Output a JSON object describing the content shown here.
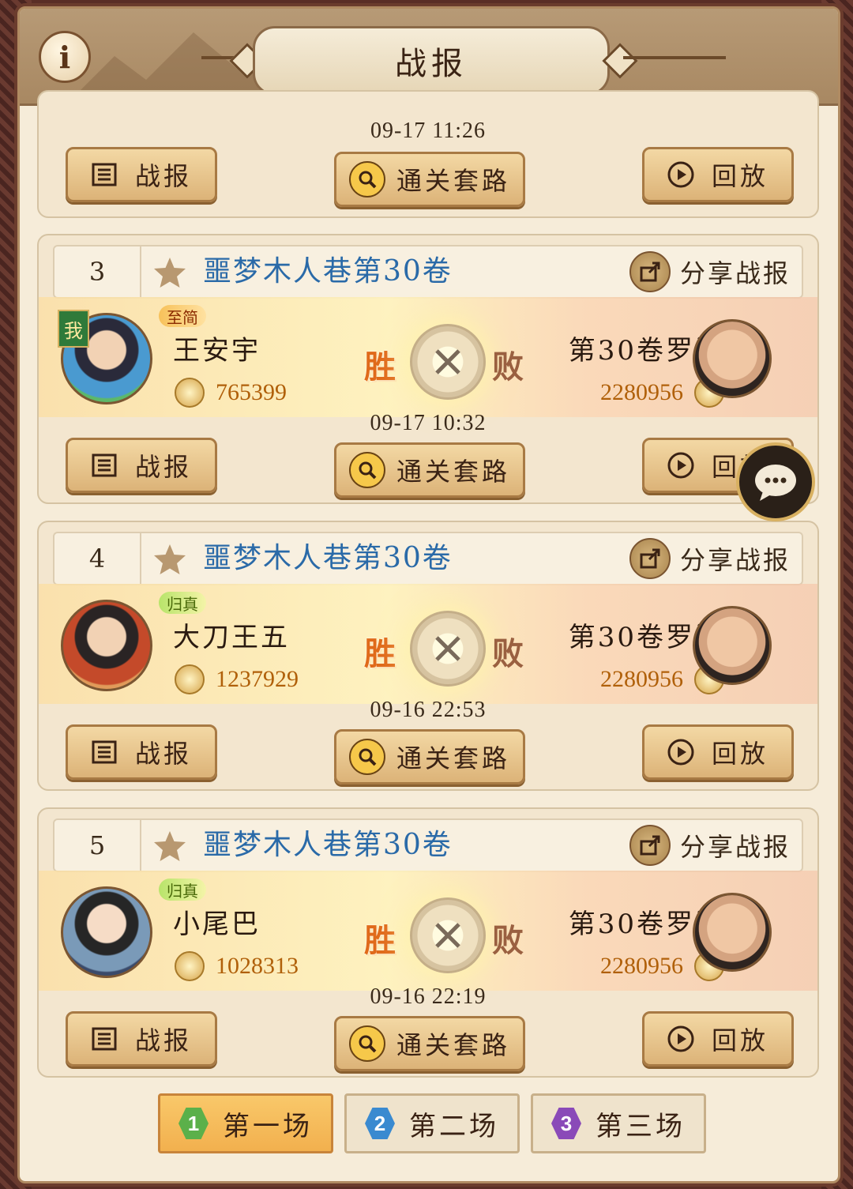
{
  "header": {
    "title": "战报",
    "info_glyph": "i"
  },
  "labels": {
    "share": "分享战报",
    "win": "胜",
    "lose": "败",
    "report": "战报",
    "route": "通关套路",
    "replay": "回放",
    "me": "我"
  },
  "top_card": {
    "time": "09-17 11:26"
  },
  "battles": [
    {
      "rank": "3",
      "stage": "噩梦木人巷第30卷",
      "player": "王安宇",
      "badge": "至简",
      "power": "765399",
      "opponent": "第30卷罗汉",
      "opp_power": "2280956",
      "time": "09-17 10:32"
    },
    {
      "rank": "4",
      "stage": "噩梦木人巷第30卷",
      "player": "大刀王五",
      "badge": "归真",
      "power": "1237929",
      "opponent": "第30卷罗汉",
      "opp_power": "2280956",
      "time": "09-16 22:53"
    },
    {
      "rank": "5",
      "stage": "噩梦木人巷第30卷",
      "player": "小尾巴",
      "badge": "归真",
      "power": "1028313",
      "opponent": "第30卷罗汉",
      "opp_power": "2280956",
      "time": "09-16 22:19"
    }
  ],
  "tabs": [
    {
      "num": "1",
      "label": "第一场",
      "color": "#5bb04a",
      "active": true
    },
    {
      "num": "2",
      "label": "第二场",
      "color": "#3a8ad0",
      "active": false
    },
    {
      "num": "3",
      "label": "第三场",
      "color": "#8a4ab8",
      "active": false
    }
  ],
  "colors": {
    "stage_blue": "#2a6aa8",
    "win_orange": "#e06a1a",
    "power_orange": "#b0600a"
  }
}
